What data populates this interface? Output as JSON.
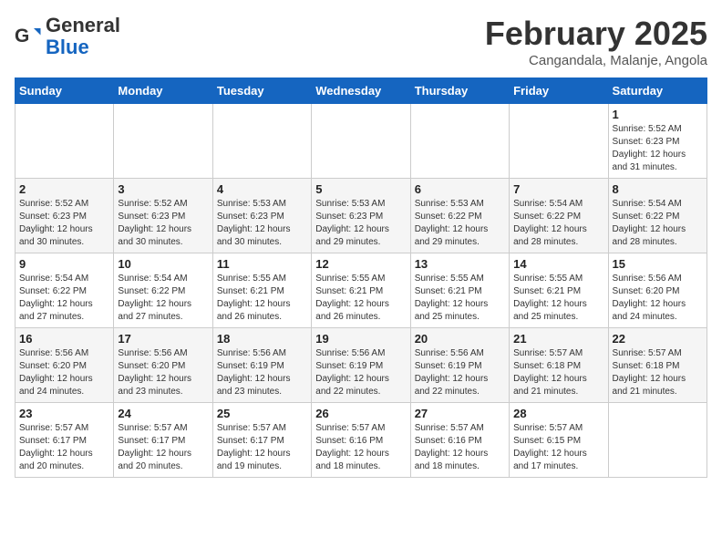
{
  "header": {
    "logo_line1": "General",
    "logo_line2": "Blue",
    "title": "February 2025",
    "subtitle": "Cangandala, Malanje, Angola"
  },
  "weekdays": [
    "Sunday",
    "Monday",
    "Tuesday",
    "Wednesday",
    "Thursday",
    "Friday",
    "Saturday"
  ],
  "weeks": [
    [
      {
        "day": "",
        "info": ""
      },
      {
        "day": "",
        "info": ""
      },
      {
        "day": "",
        "info": ""
      },
      {
        "day": "",
        "info": ""
      },
      {
        "day": "",
        "info": ""
      },
      {
        "day": "",
        "info": ""
      },
      {
        "day": "1",
        "info": "Sunrise: 5:52 AM\nSunset: 6:23 PM\nDaylight: 12 hours and 31 minutes."
      }
    ],
    [
      {
        "day": "2",
        "info": "Sunrise: 5:52 AM\nSunset: 6:23 PM\nDaylight: 12 hours and 30 minutes."
      },
      {
        "day": "3",
        "info": "Sunrise: 5:52 AM\nSunset: 6:23 PM\nDaylight: 12 hours and 30 minutes."
      },
      {
        "day": "4",
        "info": "Sunrise: 5:53 AM\nSunset: 6:23 PM\nDaylight: 12 hours and 30 minutes."
      },
      {
        "day": "5",
        "info": "Sunrise: 5:53 AM\nSunset: 6:23 PM\nDaylight: 12 hours and 29 minutes."
      },
      {
        "day": "6",
        "info": "Sunrise: 5:53 AM\nSunset: 6:22 PM\nDaylight: 12 hours and 29 minutes."
      },
      {
        "day": "7",
        "info": "Sunrise: 5:54 AM\nSunset: 6:22 PM\nDaylight: 12 hours and 28 minutes."
      },
      {
        "day": "8",
        "info": "Sunrise: 5:54 AM\nSunset: 6:22 PM\nDaylight: 12 hours and 28 minutes."
      }
    ],
    [
      {
        "day": "9",
        "info": "Sunrise: 5:54 AM\nSunset: 6:22 PM\nDaylight: 12 hours and 27 minutes."
      },
      {
        "day": "10",
        "info": "Sunrise: 5:54 AM\nSunset: 6:22 PM\nDaylight: 12 hours and 27 minutes."
      },
      {
        "day": "11",
        "info": "Sunrise: 5:55 AM\nSunset: 6:21 PM\nDaylight: 12 hours and 26 minutes."
      },
      {
        "day": "12",
        "info": "Sunrise: 5:55 AM\nSunset: 6:21 PM\nDaylight: 12 hours and 26 minutes."
      },
      {
        "day": "13",
        "info": "Sunrise: 5:55 AM\nSunset: 6:21 PM\nDaylight: 12 hours and 25 minutes."
      },
      {
        "day": "14",
        "info": "Sunrise: 5:55 AM\nSunset: 6:21 PM\nDaylight: 12 hours and 25 minutes."
      },
      {
        "day": "15",
        "info": "Sunrise: 5:56 AM\nSunset: 6:20 PM\nDaylight: 12 hours and 24 minutes."
      }
    ],
    [
      {
        "day": "16",
        "info": "Sunrise: 5:56 AM\nSunset: 6:20 PM\nDaylight: 12 hours and 24 minutes."
      },
      {
        "day": "17",
        "info": "Sunrise: 5:56 AM\nSunset: 6:20 PM\nDaylight: 12 hours and 23 minutes."
      },
      {
        "day": "18",
        "info": "Sunrise: 5:56 AM\nSunset: 6:19 PM\nDaylight: 12 hours and 23 minutes."
      },
      {
        "day": "19",
        "info": "Sunrise: 5:56 AM\nSunset: 6:19 PM\nDaylight: 12 hours and 22 minutes."
      },
      {
        "day": "20",
        "info": "Sunrise: 5:56 AM\nSunset: 6:19 PM\nDaylight: 12 hours and 22 minutes."
      },
      {
        "day": "21",
        "info": "Sunrise: 5:57 AM\nSunset: 6:18 PM\nDaylight: 12 hours and 21 minutes."
      },
      {
        "day": "22",
        "info": "Sunrise: 5:57 AM\nSunset: 6:18 PM\nDaylight: 12 hours and 21 minutes."
      }
    ],
    [
      {
        "day": "23",
        "info": "Sunrise: 5:57 AM\nSunset: 6:17 PM\nDaylight: 12 hours and 20 minutes."
      },
      {
        "day": "24",
        "info": "Sunrise: 5:57 AM\nSunset: 6:17 PM\nDaylight: 12 hours and 20 minutes."
      },
      {
        "day": "25",
        "info": "Sunrise: 5:57 AM\nSunset: 6:17 PM\nDaylight: 12 hours and 19 minutes."
      },
      {
        "day": "26",
        "info": "Sunrise: 5:57 AM\nSunset: 6:16 PM\nDaylight: 12 hours and 18 minutes."
      },
      {
        "day": "27",
        "info": "Sunrise: 5:57 AM\nSunset: 6:16 PM\nDaylight: 12 hours and 18 minutes."
      },
      {
        "day": "28",
        "info": "Sunrise: 5:57 AM\nSunset: 6:15 PM\nDaylight: 12 hours and 17 minutes."
      },
      {
        "day": "",
        "info": ""
      }
    ]
  ]
}
